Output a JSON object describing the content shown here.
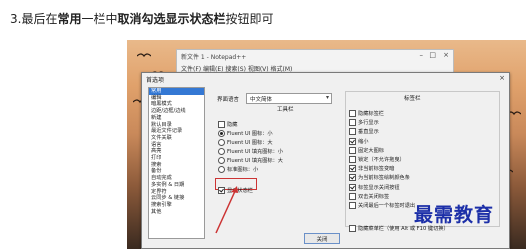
{
  "instruction": {
    "prefix": "3.最后在",
    "bold1": "常用",
    "mid": "一栏中",
    "bold2": "取消勾选显示状态栏",
    "suffix": "按钮即可"
  },
  "notepad": {
    "title": "新文件 1 - Notepad++",
    "menu": "文件(F)  编辑(E)  搜索(S)  视图(V)  格式(M)",
    "controls": {
      "minimize": "–",
      "maximize": "□",
      "close": "×"
    }
  },
  "dialog": {
    "title": "首选项",
    "close": "×",
    "categories": [
      {
        "label": "常用",
        "selected": true
      },
      {
        "label": "编辑",
        "selected": false
      },
      {
        "label": "暗黑模式",
        "selected": false
      },
      {
        "label": "边距/边框/边线",
        "selected": false
      },
      {
        "label": "新建",
        "selected": false
      },
      {
        "label": "默认目录",
        "selected": false
      },
      {
        "label": "最近文件记录",
        "selected": false
      },
      {
        "label": "文件关联",
        "selected": false
      },
      {
        "label": "语言",
        "selected": false
      },
      {
        "label": "高亮",
        "selected": false
      },
      {
        "label": "打印",
        "selected": false
      },
      {
        "label": "搜索",
        "selected": false
      },
      {
        "label": "备份",
        "selected": false
      },
      {
        "label": "自动完成",
        "selected": false
      },
      {
        "label": "多实例 & 日期",
        "selected": false
      },
      {
        "label": "定界符",
        "selected": false
      },
      {
        "label": "云同步 & 链接",
        "selected": false
      },
      {
        "label": "搜索引擎",
        "selected": false
      },
      {
        "label": "其他",
        "selected": false
      }
    ],
    "language_label": "界面语言",
    "language_value": "中文简体",
    "toolbar_title": "工具栏",
    "toolbar_options": [
      {
        "type": "checkbox",
        "label": "隐藏",
        "checked": false
      },
      {
        "type": "radio",
        "label": "Fluent UI 图标：小",
        "checked": true
      },
      {
        "type": "radio",
        "label": "Fluent UI 图标：大",
        "checked": false
      },
      {
        "type": "radio",
        "label": "Fluent UI 填充图标：小",
        "checked": false
      },
      {
        "type": "radio",
        "label": "Fluent UI 填充图标：大",
        "checked": false
      },
      {
        "type": "radio",
        "label": "标准图标：小",
        "checked": false
      }
    ],
    "show_status_bar": {
      "label": "显示状态栏",
      "checked": true
    },
    "tabbar_title": "标签栏",
    "tabbar_options": [
      {
        "label": "隐藏标签栏",
        "checked": false
      },
      {
        "label": "多行显示",
        "checked": false
      },
      {
        "label": "垂直显示",
        "checked": false
      },
      {
        "label": "缩小",
        "checked": true
      },
      {
        "label": "固定大图标",
        "checked": false
      },
      {
        "label": "锁定（不允许拖曳）",
        "checked": false
      },
      {
        "label": "非当前标签变暗",
        "checked": true
      },
      {
        "label": "为当前标签绘制颜色条",
        "checked": true
      },
      {
        "label": "标签显示关闭按钮",
        "checked": true
      },
      {
        "label": "双击关闭标签",
        "checked": false
      },
      {
        "label": "关闭最后一个标签时退出",
        "checked": false
      }
    ],
    "hide_menu_row": {
      "label": "隐藏菜单栏（使用 Alt 或 F10 键切换）",
      "checked": false
    },
    "close_button": "关闭"
  },
  "watermark": "最需教育",
  "colors": {
    "accent": "#3478d4",
    "highlight": "#cc3333",
    "watermark": "#1c2fa8"
  }
}
